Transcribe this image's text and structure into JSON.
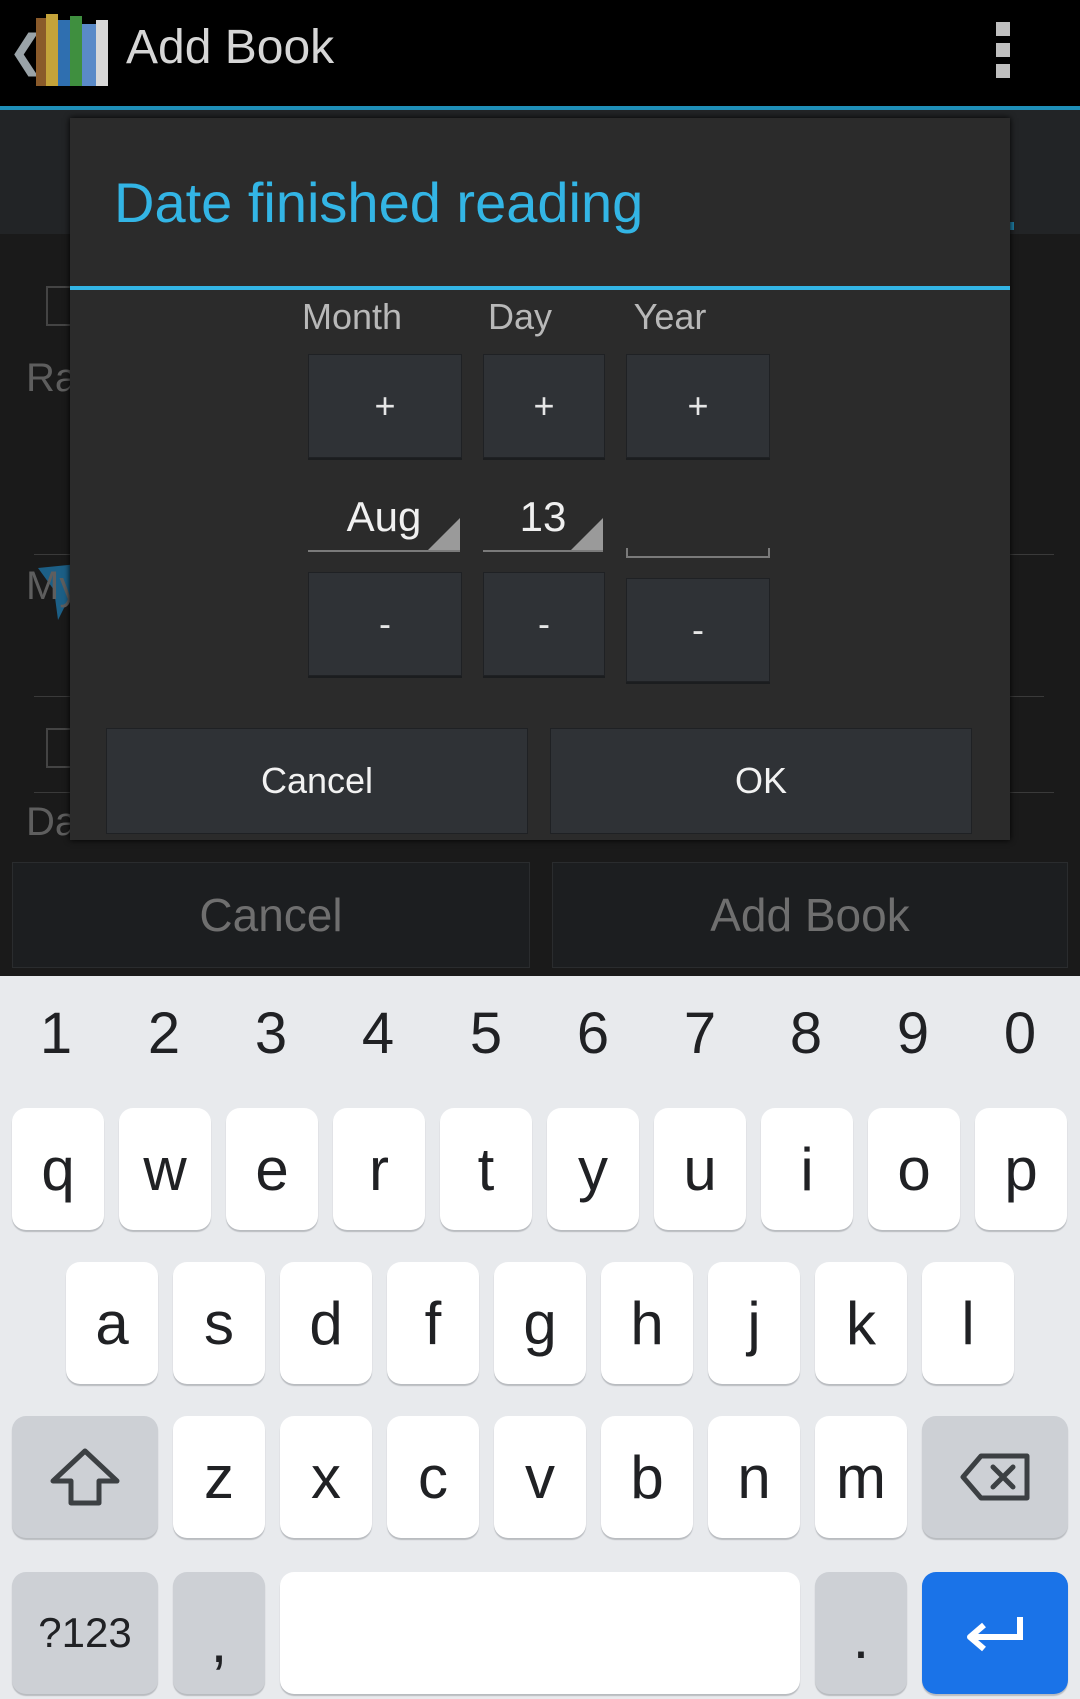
{
  "action_bar": {
    "title": "Add Book",
    "back_glyph": "❮",
    "overflow_icon": "overflow-menu-icon"
  },
  "background_form": {
    "label_rating": "Ra",
    "label_my": "My",
    "label_date": "Da",
    "cancel_label": "Cancel",
    "add_book_label": "Add Book"
  },
  "dialog": {
    "title": "Date finished reading",
    "columns": {
      "month_label": "Month",
      "day_label": "Day",
      "year_label": "Year"
    },
    "plus": "+",
    "minus": "-",
    "month_value": "Aug",
    "day_value": "13",
    "year_value": "",
    "cancel_label": "Cancel",
    "ok_label": "OK"
  },
  "keyboard": {
    "numbers": [
      "1",
      "2",
      "3",
      "4",
      "5",
      "6",
      "7",
      "8",
      "9",
      "0"
    ],
    "row1": [
      "q",
      "w",
      "e",
      "r",
      "t",
      "y",
      "u",
      "i",
      "o",
      "p"
    ],
    "row2": [
      "a",
      "s",
      "d",
      "f",
      "g",
      "h",
      "j",
      "k",
      "l"
    ],
    "row3": [
      "z",
      "x",
      "c",
      "v",
      "b",
      "n",
      "m"
    ],
    "symbols_label": "?123",
    "comma": ",",
    "period": ".",
    "enter_color": "#1a73e8"
  }
}
